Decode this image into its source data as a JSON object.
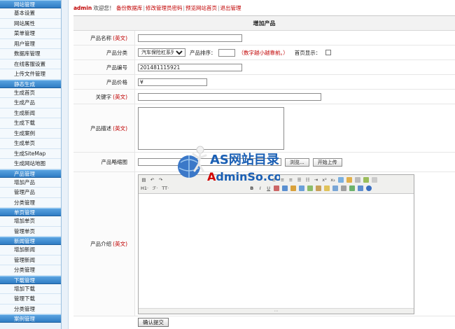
{
  "sidebar": {
    "sections": [
      {
        "title": "网站管理",
        "items": [
          "基本设置",
          "网站属性",
          "菜单管理",
          "用户管理",
          "数据库管理",
          "在线客服设置",
          "上传文件管理"
        ]
      },
      {
        "title": "静态生成",
        "items": [
          "生成首页",
          "生成产品",
          "生成新闻",
          "生成下载",
          "生成案例",
          "生成单页",
          "生成SiteMap",
          "生成网站地图"
        ]
      },
      {
        "title": "产品管理",
        "items": [
          "增加产品",
          "管理产品",
          "分类管理"
        ]
      },
      {
        "title": "单页管理",
        "items": [
          "增加单页",
          "管理单页"
        ]
      },
      {
        "title": "新闻管理",
        "items": [
          "增加新闻",
          "管理新闻",
          "分类管理"
        ]
      },
      {
        "title": "下载管理",
        "items": [
          "增加下载",
          "管理下载",
          "分类管理"
        ]
      },
      {
        "title": "案例管理",
        "items": []
      }
    ]
  },
  "topbar": {
    "user": "admin",
    "welcome": "欢迎您！",
    "links": [
      "备份数据库",
      "修改管理员密码",
      "预览网站首页",
      "退出管理"
    ]
  },
  "form": {
    "title": "增加产品",
    "name_label": "产品名称",
    "en_tag": "(英文)",
    "category_label": "产品分类",
    "category_value": "汽车保险杠系列",
    "sort_label": "产品排序：",
    "sort_hint": "（数字越小越靠前。）",
    "home_label": "首页显示：",
    "code_label": "产品编号",
    "code_value": "201481115921",
    "price_label": "产品价格",
    "price_value": "¥",
    "keyword_label": "关键字",
    "desc_label": "产品描述",
    "thumb_label": "产品略缩图",
    "browse_button": "浏览...",
    "upload_button": "开始上传",
    "intro_label": "产品介绍",
    "submit_button": "确认提交"
  },
  "editor": {
    "heading_label": "H1·",
    "font_label": "ℱ·",
    "size_label": "TT·",
    "bold_label": "B",
    "italic_label": "I",
    "underline_label": "U",
    "status_marker": "⋯"
  },
  "watermark": {
    "brand_text": "AS网站目录",
    "url_text": "AdminSo.com",
    "colors": {
      "brand": "#1a5fb4",
      "url_a": "#d10000",
      "url_rest": "#1a5fb4"
    }
  }
}
